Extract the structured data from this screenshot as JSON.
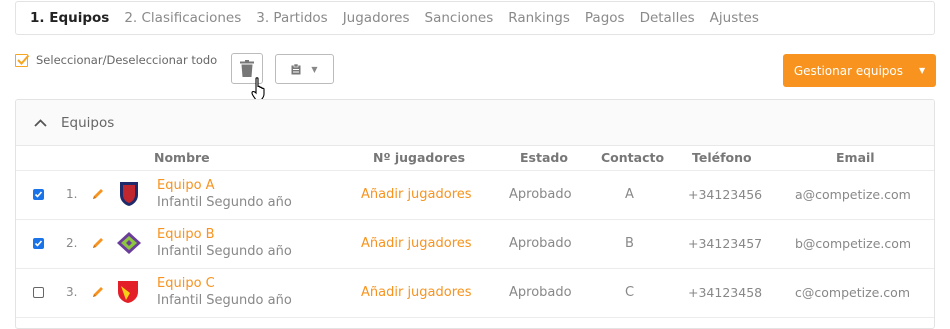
{
  "tabs": [
    {
      "label": "1. Equipos",
      "active": true
    },
    {
      "label": "2. Clasificaciones",
      "active": false
    },
    {
      "label": "3. Partidos",
      "active": false
    },
    {
      "label": "Jugadores",
      "active": false
    },
    {
      "label": "Sanciones",
      "active": false
    },
    {
      "label": "Rankings",
      "active": false
    },
    {
      "label": "Pagos",
      "active": false
    },
    {
      "label": "Detalles",
      "active": false
    },
    {
      "label": "Ajustes",
      "active": false
    }
  ],
  "toolbar": {
    "select_all_label": "Seleccionar/Deseleccionar todo",
    "delete_icon": "trash-icon",
    "clipboard_icon": "clipboard-icon",
    "manage_label": "Gestionar equipos"
  },
  "panel": {
    "title": "Equipos",
    "columns": {
      "name": "Nombre",
      "players": "Nº jugadores",
      "status": "Estado",
      "contact": "Contacto",
      "phone": "Teléfono",
      "email": "Email"
    },
    "rows": [
      {
        "checked": true,
        "num": "1.",
        "name": "Equipo A",
        "category": "Infantil Segundo año",
        "players": "Añadir jugadores",
        "status": "Aprobado",
        "contact": "A",
        "phone": "+34123456",
        "email": "a@competize.com"
      },
      {
        "checked": true,
        "num": "2.",
        "name": "Equipo B",
        "category": "Infantil Segundo año",
        "players": "Añadir jugadores",
        "status": "Aprobado",
        "contact": "B",
        "phone": "+34123457",
        "email": "b@competize.com"
      },
      {
        "checked": false,
        "num": "3.",
        "name": "Equipo C",
        "category": "Infantil Segundo año",
        "players": "Añadir jugadores",
        "status": "Aprobado",
        "contact": "C",
        "phone": "+34123458",
        "email": "c@competize.com"
      }
    ]
  },
  "colors": {
    "accent": "#f7931e",
    "checkbox": "#1a73e8",
    "border": "#e3e3e3"
  }
}
